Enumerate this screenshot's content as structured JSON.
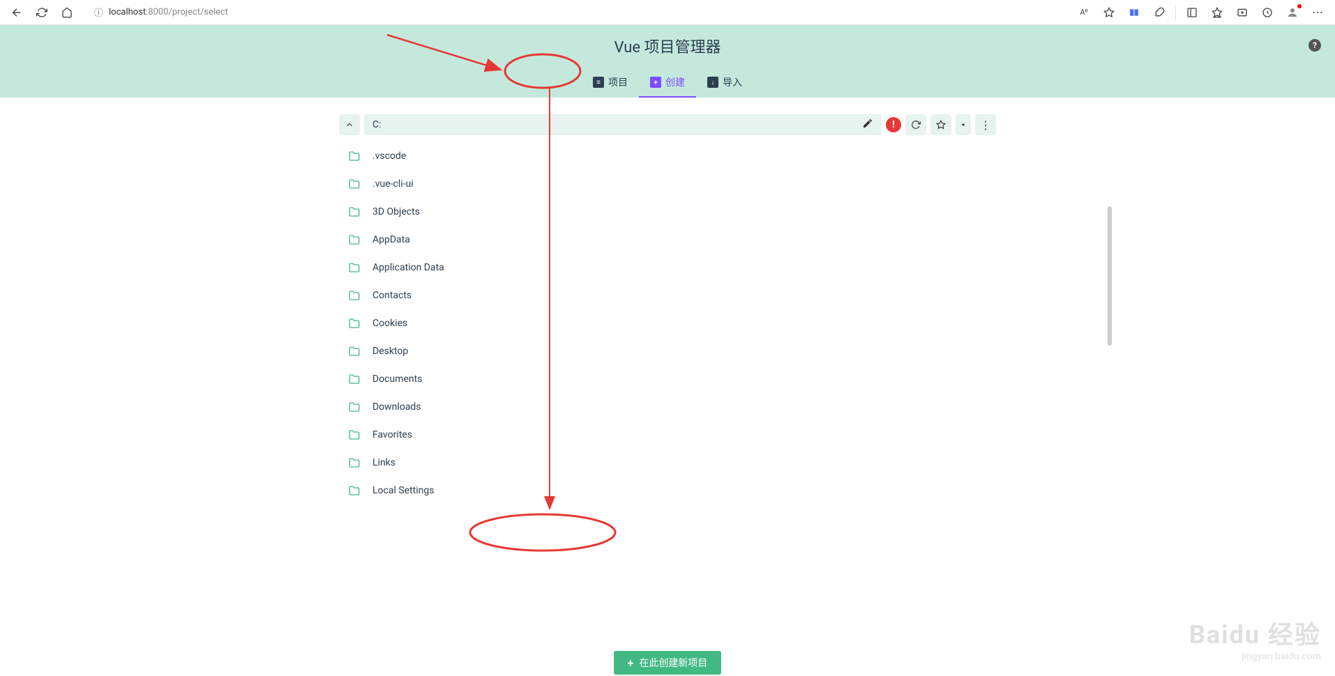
{
  "browser": {
    "url_host": "localhost",
    "url_port_path": ":8000/project/select",
    "read_aloud": "A⁰"
  },
  "header": {
    "title": "Vue 项目管理器"
  },
  "tabs": [
    {
      "label": "项目",
      "icon": "list"
    },
    {
      "label": "创建",
      "icon": "plus"
    },
    {
      "label": "导入",
      "icon": "import"
    }
  ],
  "path": {
    "current": "C:"
  },
  "folders": [
    {
      "name": ".vscode"
    },
    {
      "name": ".vue-cli-ui"
    },
    {
      "name": "3D Objects"
    },
    {
      "name": "AppData"
    },
    {
      "name": "Application Data"
    },
    {
      "name": "Contacts"
    },
    {
      "name": "Cookies"
    },
    {
      "name": "Desktop"
    },
    {
      "name": "Documents"
    },
    {
      "name": "Downloads"
    },
    {
      "name": "Favorites"
    },
    {
      "name": "Links"
    },
    {
      "name": "Local Settings"
    }
  ],
  "create_button": {
    "label": "在此创建新项目"
  },
  "watermark": {
    "brand": "Baidu 经验",
    "url": "jingyan.baidu.com"
  }
}
